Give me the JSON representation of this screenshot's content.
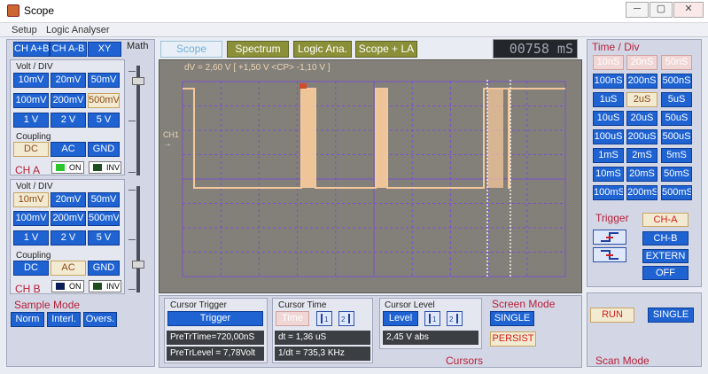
{
  "window": {
    "title": "Scope",
    "min": "─",
    "max": "▢",
    "close": "✕"
  },
  "menu": [
    "Setup",
    "Logic Analyser"
  ],
  "topbar": {
    "tabs": [
      "Scope",
      "Spectrum",
      "Logic Ana.",
      "Scope + LA"
    ],
    "counter": "00758 mS"
  },
  "mode_buttons": [
    "CH A+B",
    "CH A-B",
    "XY"
  ],
  "math_label": "Math",
  "cha": {
    "voltdiv_label": "Volt / DIV",
    "volts": [
      "10mV",
      "20mV",
      "50mV",
      "100mV",
      "200mV",
      "500mV",
      "1 V",
      "2 V",
      "5 V"
    ],
    "selected_volt": "500mV",
    "coupling_label": "Coupling",
    "coupling": [
      "DC",
      "AC",
      "GND"
    ],
    "selected_coupling": "DC",
    "name": "CH A",
    "on_label": "ON",
    "inv_label": "INV"
  },
  "chb": {
    "voltdiv_label": "Volt / DIV",
    "volts": [
      "10mV",
      "20mV",
      "50mV",
      "100mV",
      "200mV",
      "500mV",
      "1 V",
      "2 V",
      "5 V"
    ],
    "selected_volt": "10mV",
    "coupling_label": "Coupling",
    "coupling": [
      "DC",
      "AC",
      "GND"
    ],
    "selected_coupling": "AC",
    "name": "CH B",
    "on_label": "ON",
    "inv_label": "INV"
  },
  "sample": {
    "label": "Sample Mode",
    "buttons": [
      "Norm",
      "Interl.",
      "Overs."
    ]
  },
  "scope": {
    "dv_text": "dV = 2,60 V [ +1,50 V <CP> -1,10 V ]",
    "ch_marker": "CH1",
    "trace_color": "#f3c79b",
    "grid_color": "#7a52c8",
    "bg_color": "#83807a"
  },
  "cursor_trigger": {
    "label": "Cursor Trigger",
    "button": "Trigger",
    "pretrtime": "PreTrTime=720,00nS",
    "pretrlevel": "PreTrLevel = 7,78Volt"
  },
  "cursor_time": {
    "label": "Cursor Time",
    "button": "Time",
    "dt": "dt     = 1,36 uS",
    "freq": "1/dt = 735,3 KHz"
  },
  "cursor_level": {
    "label": "Cursor  Level",
    "button": "Level",
    "value": "2,45 V abs"
  },
  "cursors_label": "Cursors",
  "screen_mode": {
    "label": "Screen Mode",
    "single": "SINGLE",
    "persist": "PERSIST"
  },
  "timediv": {
    "label": "Time / Div",
    "values": [
      "10nS",
      "20nS",
      "50nS",
      "100nS",
      "200nS",
      "500nS",
      "1uS",
      "2uS",
      "5uS",
      "10uS",
      "20uS",
      "50uS",
      "100uS",
      "200uS",
      "500uS",
      "1mS",
      "2mS",
      "5mS",
      "10mS",
      "20mS",
      "50mS",
      "100mS",
      "200mS",
      "500mS"
    ],
    "disabled": [
      "10nS",
      "20nS",
      "50nS"
    ],
    "selected": "2uS"
  },
  "trigger": {
    "label": "Trigger",
    "cha": "CH-A",
    "chb": "CH-B",
    "extern": "EXTERN",
    "off": "OFF"
  },
  "scan": {
    "label": "Scan Mode",
    "run": "RUN",
    "single": "SINGLE"
  }
}
